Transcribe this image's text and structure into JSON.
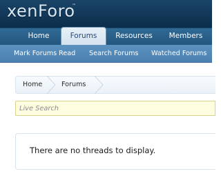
{
  "logo": {
    "text": "xenForo",
    "mark": "™"
  },
  "nav": {
    "tabs": [
      {
        "label": "Home",
        "selected": false
      },
      {
        "label": "Forums",
        "selected": true
      },
      {
        "label": "Resources",
        "selected": false
      },
      {
        "label": "Members",
        "selected": false
      }
    ]
  },
  "subnav": {
    "links": [
      "Mark Forums Read",
      "Search Forums",
      "Watched Forums"
    ]
  },
  "breadcrumb": {
    "items": [
      "Home",
      "Forums"
    ]
  },
  "search": {
    "placeholder": "Live Search",
    "value": ""
  },
  "notice": {
    "text": "There are no threads to display."
  },
  "colors": {
    "header": "#0c2d4b",
    "navbar": "#24557d",
    "subnav": "#4a7fae",
    "selected_tab": "#e7f0f7",
    "search_bg": "#fffde0"
  }
}
